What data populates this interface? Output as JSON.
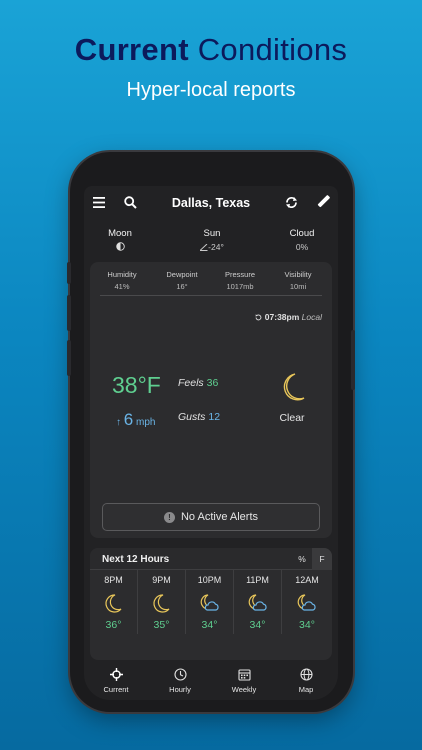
{
  "promo": {
    "headline_bold": "Current",
    "headline_rest": "Conditions",
    "subheadline": "Hyper-local reports"
  },
  "topbar": {
    "title": "Dallas, Texas",
    "icons": [
      "menu-icon",
      "search-icon",
      "refresh-icon",
      "ruler-icon"
    ]
  },
  "astro": {
    "moon": {
      "label": "Moon",
      "icon": "half-moon-icon"
    },
    "sun": {
      "label": "Sun",
      "value": "-24°"
    },
    "cloud": {
      "label": "Cloud",
      "value": "0%"
    }
  },
  "stats": [
    {
      "label": "Humidity",
      "value": "41%"
    },
    {
      "label": "Dewpoint",
      "value": "16°"
    },
    {
      "label": "Pressure",
      "value": "1017mb"
    },
    {
      "label": "Visibility",
      "value": "10mi"
    }
  ],
  "current": {
    "time": "07:38pm",
    "time_suffix": "Local",
    "temperature": "38°F",
    "wind_arrow": "↑",
    "wind_speed": "6",
    "wind_unit": "mph",
    "feels_label": "Feels",
    "feels_value": "36",
    "gusts_label": "Gusts",
    "gusts_value": "12",
    "condition": "Clear",
    "condition_icon": "crescent-moon-icon",
    "alerts_text": "No Active Alerts",
    "alerts_glyph": "!"
  },
  "hourly": {
    "title": "Next 12 Hours",
    "units": [
      "%",
      "F"
    ],
    "hours": [
      {
        "time": "8PM",
        "temp": "36°",
        "icon": "crescent-moon-icon"
      },
      {
        "time": "9PM",
        "temp": "35°",
        "icon": "crescent-moon-icon"
      },
      {
        "time": "10PM",
        "temp": "34°",
        "icon": "moon-cloud-icon"
      },
      {
        "time": "11PM",
        "temp": "34°",
        "icon": "moon-cloud-icon"
      },
      {
        "time": "12AM",
        "temp": "34°",
        "icon": "moon-cloud-icon"
      }
    ]
  },
  "nav": [
    {
      "label": "Current",
      "icon": "crosshair-icon"
    },
    {
      "label": "Hourly",
      "icon": "clock-icon"
    },
    {
      "label": "Weekly",
      "icon": "calendar-icon"
    },
    {
      "label": "Map",
      "icon": "globe-icon"
    }
  ],
  "colors": {
    "background_top": "#1aa3d6",
    "background_bottom": "#066aa0",
    "headline": "#0c1a5c",
    "temp_green": "#5fcf90",
    "wind_blue": "#6ab4e6",
    "moon_yellow": "#e8c65a"
  }
}
